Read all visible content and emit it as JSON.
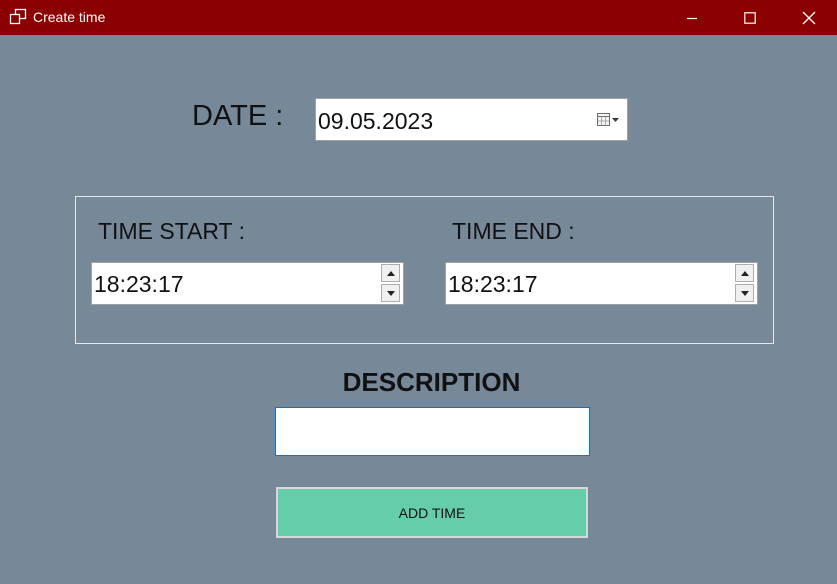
{
  "window": {
    "title": "Create time",
    "titlebar_color": "#8b0000",
    "background_color": "#778899",
    "controls": [
      "minimize-icon",
      "maximize-icon",
      "close-icon"
    ]
  },
  "date": {
    "label": "DATE :",
    "value": "09.05.2023",
    "icon": "calendar-dropdown-icon"
  },
  "time": {
    "start_label": "TIME START :",
    "start_value": "18:23:17",
    "end_label": "TIME END :",
    "end_value": "18:23:17"
  },
  "description": {
    "label": "DESCRIPTION",
    "value": ""
  },
  "actions": {
    "add_label": "ADD TIME",
    "add_color": "#66cdaa"
  }
}
